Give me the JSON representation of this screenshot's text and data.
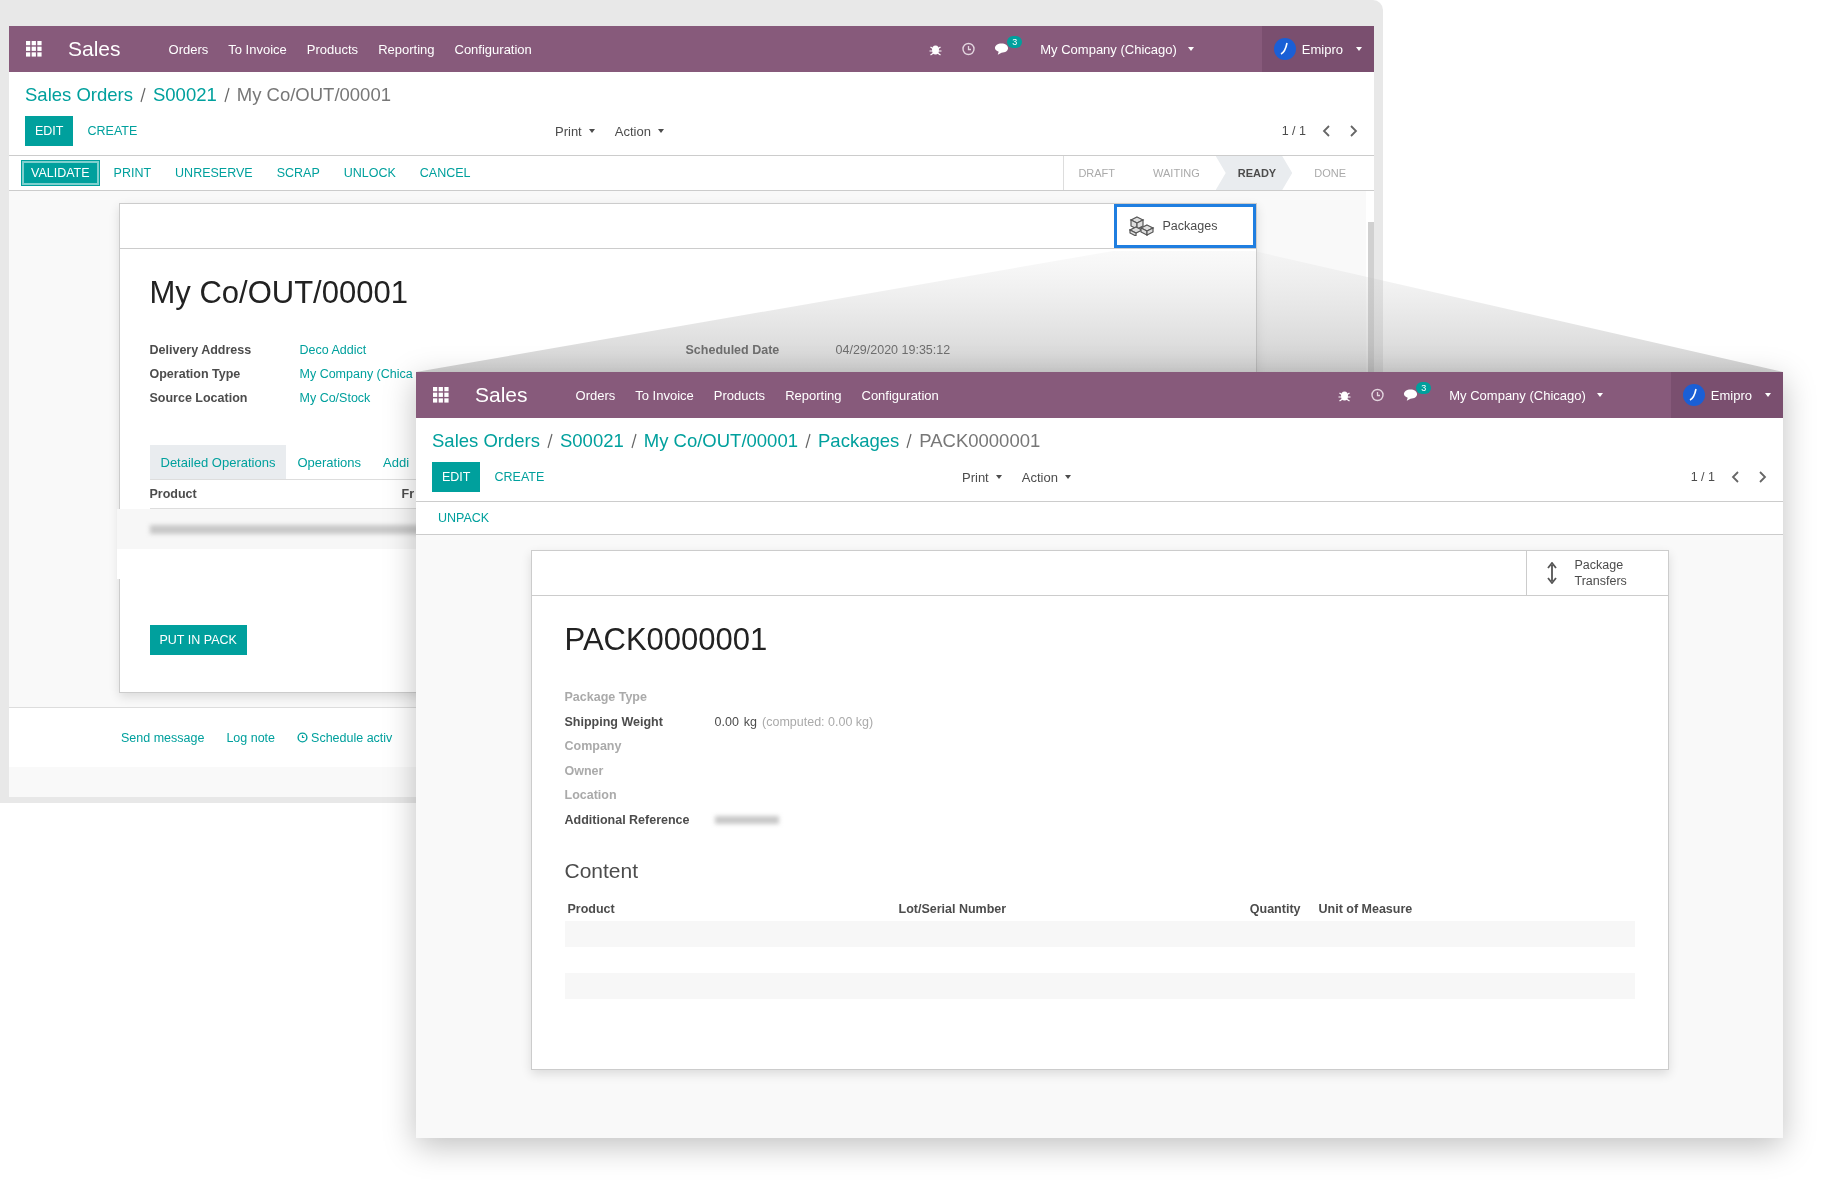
{
  "back_window": {
    "navbar": {
      "app": "Sales",
      "menu": [
        "Orders",
        "To Invoice",
        "Products",
        "Reporting",
        "Configuration"
      ],
      "messages_count": "3",
      "company": "My Company (Chicago)",
      "user": "Emipro"
    },
    "breadcrumb": [
      {
        "label": "Sales Orders",
        "link": true
      },
      {
        "label": "S00021",
        "link": true
      },
      {
        "label": "My Co/OUT/00001",
        "link": false
      }
    ],
    "control_buttons": [
      {
        "label": "EDIT",
        "kind": "primary"
      },
      {
        "label": "CREATE",
        "kind": "link"
      }
    ],
    "dropdowns": [
      "Print",
      "Action"
    ],
    "pager": "1 / 1",
    "header_buttons": [
      {
        "label": "VALIDATE",
        "kind": "primary"
      },
      {
        "label": "PRINT",
        "kind": "link"
      },
      {
        "label": "UNRESERVE",
        "kind": "link"
      },
      {
        "label": "SCRAP",
        "kind": "link"
      },
      {
        "label": "UNLOCK",
        "kind": "link"
      },
      {
        "label": "CANCEL",
        "kind": "link"
      }
    ],
    "status_steps": [
      {
        "label": "DRAFT",
        "selected": false
      },
      {
        "label": "WAITING",
        "selected": false
      },
      {
        "label": "READY",
        "selected": true
      },
      {
        "label": "DONE",
        "selected": false
      }
    ],
    "smart_button": {
      "label": "Packages",
      "highlighted": true
    },
    "title": "My Co/OUT/00001",
    "fields_left": [
      {
        "label": "Delivery Address",
        "value": "Deco Addict"
      },
      {
        "label": "Operation Type",
        "value": "My Company (Chica"
      },
      {
        "label": "Source Location",
        "value": "My Co/Stock"
      }
    ],
    "fields_right": [
      {
        "label": "Scheduled Date",
        "value": "04/29/2020 19:35:12"
      }
    ],
    "tabs": [
      {
        "label": "Detailed Operations",
        "selected": true
      },
      {
        "label": "Operations",
        "selected": false
      },
      {
        "label": "Addi",
        "selected": false
      }
    ],
    "table_columns": [
      "Product",
      "Fr"
    ],
    "footer_button": "PUT IN PACK",
    "chatter": [
      {
        "label": "Send message",
        "kind": "message"
      },
      {
        "label": "Log note",
        "kind": "note"
      },
      {
        "label": "Schedule activ",
        "kind": "activity"
      }
    ]
  },
  "front_window": {
    "navbar": {
      "app": "Sales",
      "menu": [
        "Orders",
        "To Invoice",
        "Products",
        "Reporting",
        "Configuration"
      ],
      "messages_count": "3",
      "company": "My Company (Chicago)",
      "user": "Emipro"
    },
    "breadcrumb": [
      {
        "label": "Sales Orders",
        "link": true
      },
      {
        "label": "S00021",
        "link": true
      },
      {
        "label": "My Co/OUT/00001",
        "link": true
      },
      {
        "label": "Packages",
        "link": true
      },
      {
        "label": "PACK0000001",
        "link": false
      }
    ],
    "control_buttons": [
      {
        "label": "EDIT",
        "kind": "primary"
      },
      {
        "label": "CREATE",
        "kind": "link"
      }
    ],
    "dropdowns": [
      "Print",
      "Action"
    ],
    "pager": "1 / 1",
    "header_buttons": [
      {
        "label": "UNPACK",
        "kind": "link"
      }
    ],
    "smart_button": {
      "label": "Package Transfers",
      "highlighted": false
    },
    "title": "PACK0000001",
    "fields": [
      {
        "label": "Package Type",
        "kind": "empty"
      },
      {
        "label": "Shipping Weight",
        "kind": "weight",
        "value": "0.00",
        "unit": "kg",
        "computed": "(computed: 0.00 kg)"
      },
      {
        "label": "Company",
        "kind": "empty"
      },
      {
        "label": "Owner",
        "kind": "empty"
      },
      {
        "label": "Location",
        "kind": "empty"
      },
      {
        "label": "Additional Reference",
        "kind": "blurred"
      }
    ],
    "section_title": "Content",
    "table_columns": [
      "Product",
      "Lot/Serial Number",
      "Quantity",
      "Unit of Measure"
    ]
  }
}
